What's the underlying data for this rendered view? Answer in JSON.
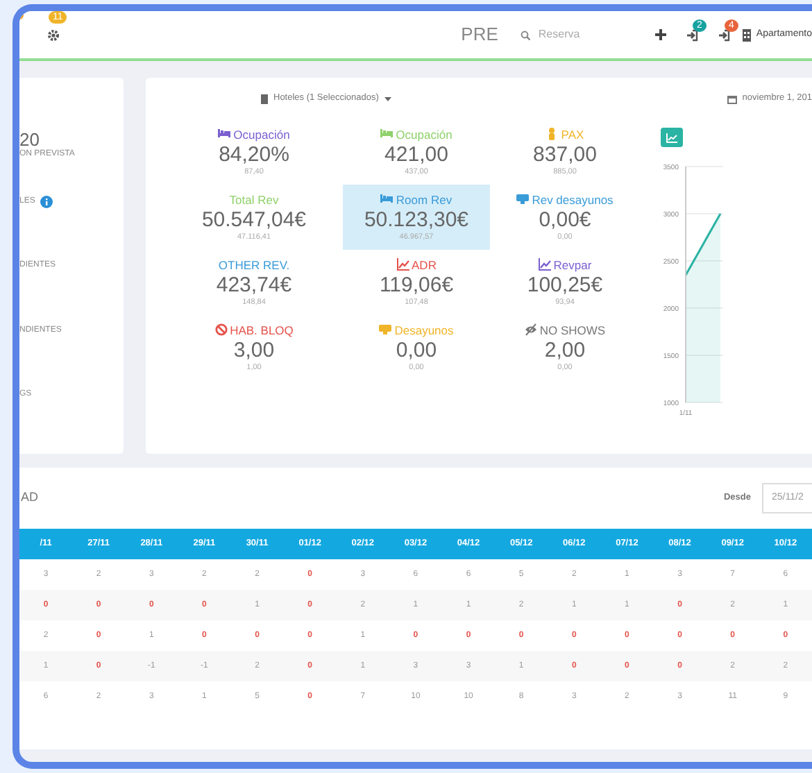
{
  "topbar": {
    "corner_badge_dot": true,
    "settings_badge": "11",
    "title": "PRE",
    "search": {
      "placeholder": "Reserva"
    },
    "checkin_badge": "2",
    "checkout_badge": "4",
    "property": "Apartamento"
  },
  "sidebar": {
    "items": [
      {
        "value": "20",
        "label": "ON PREVISTA",
        "info": false
      },
      {
        "label": "LES",
        "info": true
      },
      {
        "label": "DIENTES",
        "info": false
      },
      {
        "label": "NDIENTES",
        "info": false
      },
      {
        "label": "GS",
        "info": false
      }
    ]
  },
  "dashboard": {
    "hotel_filter": "Hoteles (1 Seleccionados)",
    "date": "noviembre 1, 201",
    "kpis": [
      {
        "kind": "bed",
        "label": "Ocupación",
        "color": "#7b5fd0",
        "value": "84,20%",
        "previous": "87,40",
        "selected": false
      },
      {
        "kind": "bed",
        "label": "Ocupación",
        "color": "#8fd16b",
        "value": "421,00",
        "previous": "437,00",
        "selected": false
      },
      {
        "kind": "person",
        "label": "PAX",
        "color": "#f0b429",
        "value": "837,00",
        "previous": "885,00",
        "selected": false
      },
      {
        "kind": "none",
        "label": "Total Rev",
        "color": "#8fd16b",
        "value": "50.547,04€",
        "previous": "47.116,41",
        "selected": false
      },
      {
        "kind": "bed",
        "label": "Room Rev",
        "color": "#3a9bd9",
        "value": "50.123,30€",
        "previous": "46.967,57",
        "selected": true
      },
      {
        "kind": "tray",
        "label": "Rev desayunos",
        "color": "#3a9bd9",
        "value": "0,00€",
        "previous": "0,00",
        "selected": false
      },
      {
        "kind": "none",
        "label": "OTHER REV.",
        "color": "#3a9bd9",
        "value": "423,74€",
        "previous": "148,84",
        "selected": false
      },
      {
        "kind": "trend",
        "label": "ADR",
        "color": "#e5534b",
        "value": "119,06€",
        "previous": "107,48",
        "selected": false
      },
      {
        "kind": "trend",
        "label": "Revpar",
        "color": "#7b5fd0",
        "value": "100,25€",
        "previous": "93,94",
        "selected": false
      },
      {
        "kind": "ban",
        "label": "HAB. BLOQ",
        "color": "#e5534b",
        "value": "3,00",
        "previous": "1,00",
        "selected": false
      },
      {
        "kind": "tray",
        "label": "Desayunos",
        "color": "#f0b429",
        "value": "0,00",
        "previous": "0,00",
        "selected": false
      },
      {
        "kind": "hidden",
        "label": "NO SHOWS",
        "color": "#777777",
        "value": "2,00",
        "previous": "0,00",
        "selected": false
      }
    ],
    "chart": {
      "y_labels": [
        "3500",
        "3000",
        "2500",
        "2000",
        "1500",
        "1000"
      ],
      "x_label": "1/11"
    }
  },
  "availability": {
    "title": "AD",
    "from_label": "Desde",
    "from_value": "25/11/2",
    "columns": [
      "/11",
      "27/11",
      "28/11",
      "29/11",
      "30/11",
      "01/12",
      "02/12",
      "03/12",
      "04/12",
      "05/12",
      "06/12",
      "07/12",
      "08/12",
      "09/12",
      "10/12"
    ],
    "rows": [
      {
        "values": [
          "3",
          "2",
          "3",
          "2",
          "2",
          "0",
          "3",
          "6",
          "6",
          "5",
          "2",
          "1",
          "3",
          "7",
          "6"
        ],
        "alert": [
          false,
          false,
          false,
          false,
          false,
          true,
          false,
          false,
          false,
          false,
          false,
          false,
          false,
          false,
          false
        ]
      },
      {
        "values": [
          "0",
          "0",
          "0",
          "0",
          "1",
          "0",
          "2",
          "1",
          "1",
          "2",
          "1",
          "1",
          "0",
          "2",
          "1"
        ],
        "alert": [
          true,
          true,
          true,
          true,
          false,
          true,
          false,
          false,
          false,
          false,
          false,
          false,
          true,
          false,
          false
        ]
      },
      {
        "values": [
          "2",
          "0",
          "1",
          "0",
          "0",
          "0",
          "1",
          "0",
          "0",
          "0",
          "0",
          "0",
          "0",
          "0",
          "0"
        ],
        "alert": [
          false,
          true,
          false,
          true,
          true,
          true,
          false,
          true,
          true,
          true,
          true,
          true,
          true,
          true,
          true
        ]
      },
      {
        "values": [
          "1",
          "0",
          "-1",
          "-1",
          "2",
          "0",
          "1",
          "3",
          "3",
          "1",
          "0",
          "0",
          "0",
          "2",
          "2"
        ],
        "alert": [
          false,
          true,
          false,
          false,
          false,
          true,
          false,
          false,
          false,
          false,
          true,
          true,
          true,
          false,
          false
        ]
      },
      {
        "values": [
          "6",
          "2",
          "3",
          "1",
          "5",
          "0",
          "7",
          "10",
          "10",
          "8",
          "3",
          "2",
          "3",
          "11",
          "9"
        ],
        "alert": [
          false,
          false,
          false,
          false,
          false,
          true,
          false,
          false,
          false,
          false,
          false,
          false,
          false,
          false,
          false
        ]
      }
    ]
  }
}
